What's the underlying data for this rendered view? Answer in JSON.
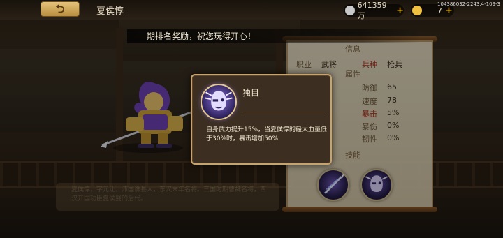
{
  "header": {
    "title": "夏侯惇",
    "gold": {
      "value": "641359万",
      "color": "#c9c9c9"
    },
    "gems": {
      "value": "7",
      "color": "#f0c040"
    },
    "build_id": "104386032-2243.4-109-3",
    "back_icon": "back-arrow-icon",
    "plus_icon": "plus-icon"
  },
  "banner": {
    "text": "期排名奖励，祝您玩得开心！"
  },
  "info": {
    "section_info": "信息",
    "rows": [
      {
        "label": "职业",
        "value": "武将"
      },
      {
        "label": "兵种",
        "value": "枪兵"
      }
    ],
    "section_attr": "属性",
    "attrs": [
      {
        "label": "防御",
        "value": "65",
        "red": false
      },
      {
        "label": "速度",
        "value": "78",
        "red": false
      },
      {
        "label": "暴击",
        "value": "5%",
        "red": true
      },
      {
        "label": "暴伤",
        "value": "0%",
        "red": false
      },
      {
        "label": "韧性",
        "value": "0%",
        "red": false
      }
    ],
    "section_skill": "技能",
    "skills": [
      {
        "icon": "spear-strike-icon"
      },
      {
        "icon": "one-eye-warrior-icon"
      }
    ]
  },
  "description": {
    "text": "夏侯惇，字元让，沛国谯县人，东汉末年名将。三国时期曹魏名将，西汉开国功臣夏侯婴的后代。"
  },
  "popup": {
    "skill_name": "独目",
    "icon": "one-eye-warrior-icon",
    "description": "自身武力提升15%，当夏侯惇的最大血量低于30%时，暴击增加50%",
    "accent": "#c8a46a"
  }
}
